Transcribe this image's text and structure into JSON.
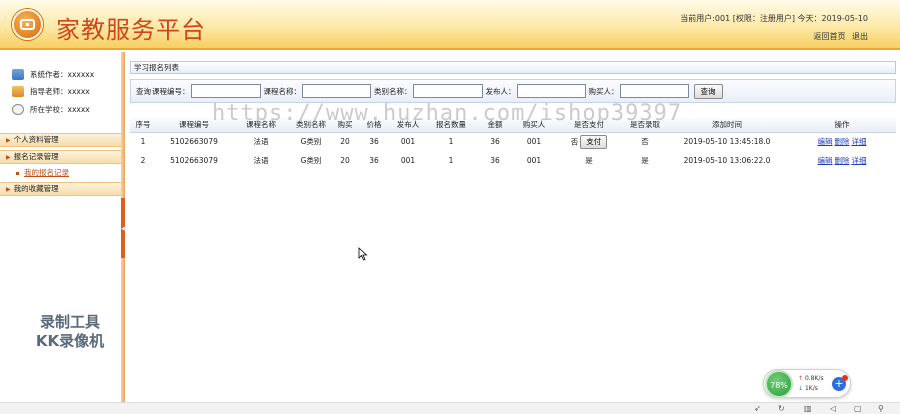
{
  "header": {
    "title": "家教服务平台",
    "user_info": "当前用户:001 [权限：注册用户] 今天：2019-05-10",
    "links": [
      "返回首页",
      "退出"
    ]
  },
  "sidebar": {
    "info": [
      {
        "label": "系统作者：xxxxxx",
        "icon": "author-icon"
      },
      {
        "label": "指导老师：xxxxx",
        "icon": "teacher-icon"
      },
      {
        "label": "所在学校：xxxxx",
        "icon": "school-icon"
      }
    ],
    "menus": [
      {
        "label": "个人资料管理"
      },
      {
        "label": "报名记录管理"
      },
      {
        "label": "我的收藏管理"
      }
    ],
    "sub_item": "我的报名记录"
  },
  "panel_title": "学习报名列表",
  "search": {
    "prefix": "查询",
    "fields": [
      "课程编号：",
      "课程名称：",
      "类别名称：",
      "发布人：",
      "购买人："
    ],
    "button": "查询"
  },
  "table": {
    "headers": [
      "序号",
      "课程编号",
      "课程名称",
      "类别名称",
      "购买",
      "价格",
      "发布人",
      "报名数量",
      "金额",
      "购买人",
      "是否支付",
      "是否录取",
      "添加时间",
      "操作"
    ],
    "rows": [
      [
        "1",
        "5102663079",
        "法语",
        "G类别",
        "20",
        "36",
        "001",
        "1",
        "36",
        "001",
        "否",
        "否",
        "2019-05-10 13:45:18.0"
      ],
      [
        "2",
        "5102663079",
        "法语",
        "G类别",
        "20",
        "36",
        "001",
        "1",
        "36",
        "001",
        "是",
        "是",
        "2019-05-10 13:06:22.0"
      ]
    ],
    "pay_button": "支付",
    "actions": [
      "编辑",
      "删除",
      "详细"
    ]
  },
  "watermark": {
    "url": "https://www.huzhan.com/ishop39397",
    "recorder": [
      "录制工具",
      "KK录像机"
    ]
  },
  "net_widget": {
    "percent": "78%",
    "up": "0.8K/s",
    "down": "1K/s"
  },
  "colors": {
    "title": "#d0451b",
    "accent": "#e8a838",
    "link": "#1f3fb6"
  }
}
